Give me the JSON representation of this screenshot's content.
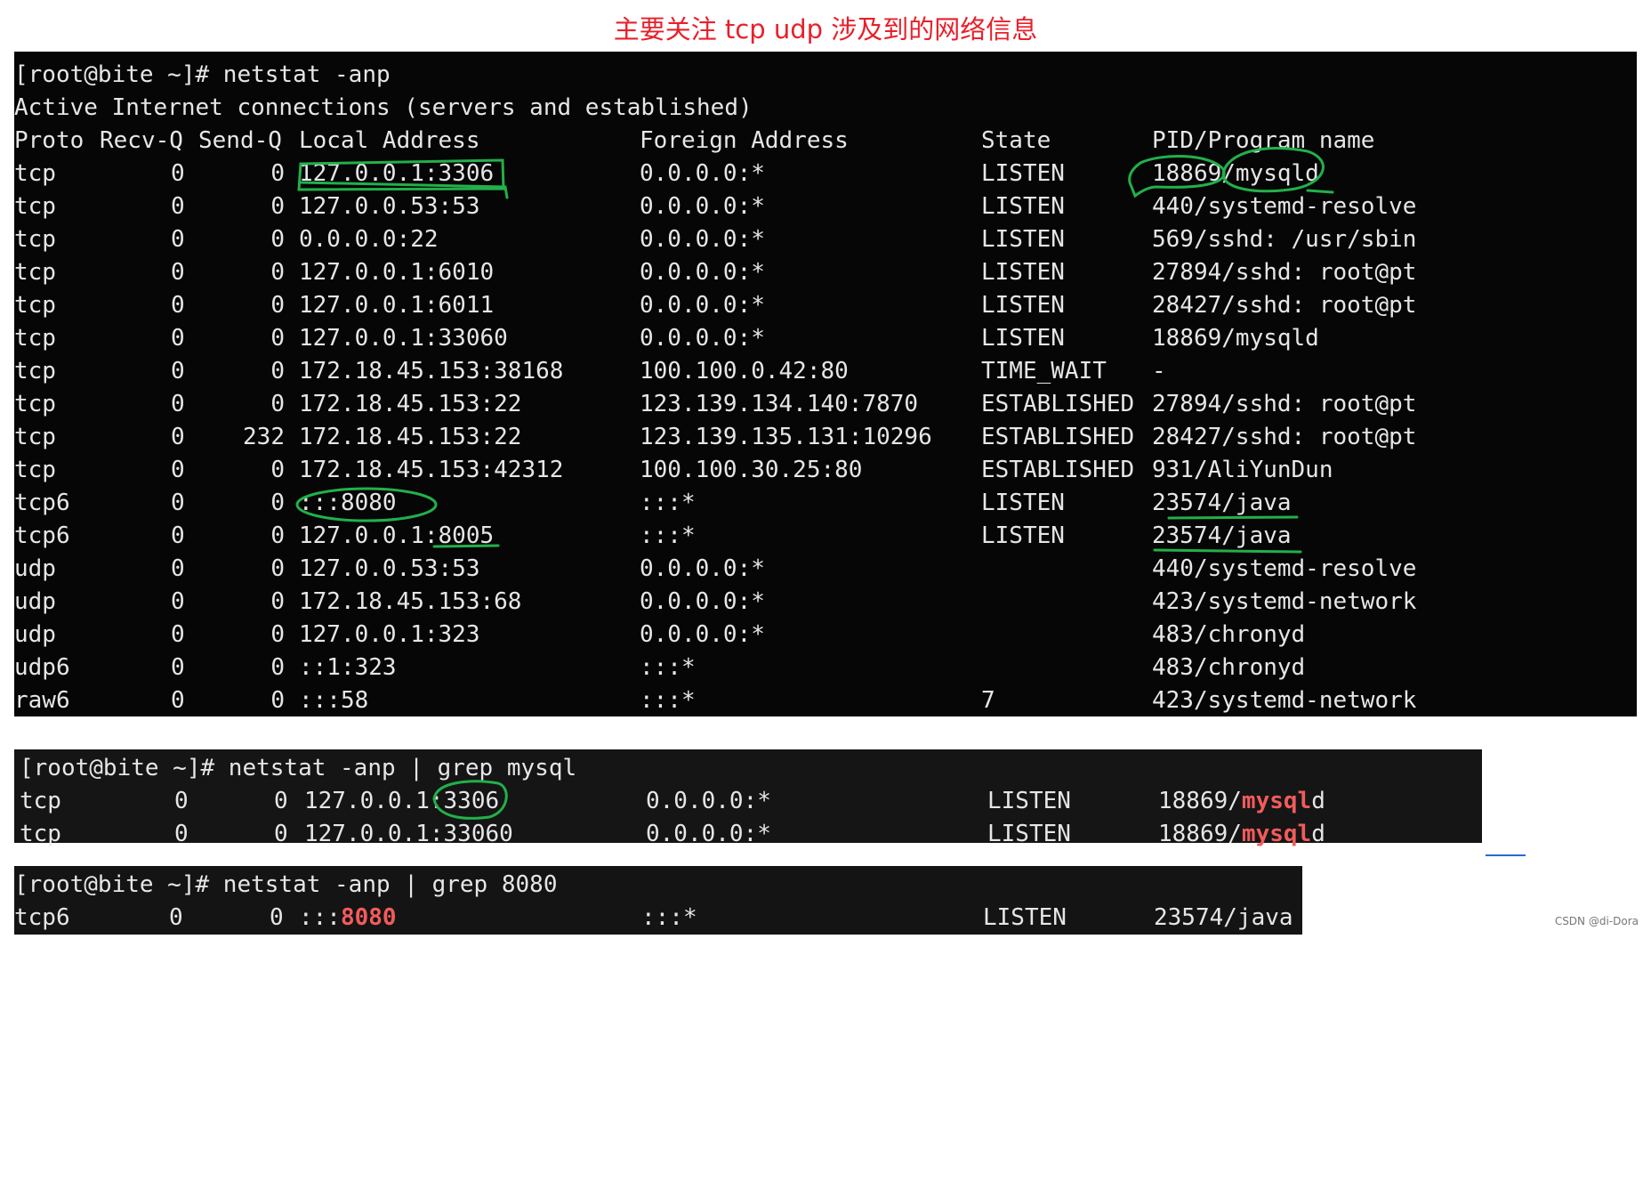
{
  "title": "主要关注 tcp udp 涉及到的网络信息",
  "watermark": "CSDN @di-Dora",
  "term1": {
    "prompt": "[root@bite ~]# netstat -anp",
    "subtitle": "Active Internet connections (servers and established)",
    "headers": {
      "proto": "Proto",
      "recvq": "Recv-Q",
      "sendq": "Send-Q",
      "local": "Local Address",
      "foreign": "Foreign Address",
      "state": "State",
      "pid": "PID/Program name"
    },
    "rows": [
      {
        "proto": "tcp",
        "recvq": "0",
        "sendq": "0",
        "local": "127.0.0.1:3306",
        "foreign": "0.0.0.0:*",
        "state": "LISTEN",
        "pid": "18869/mysqld"
      },
      {
        "proto": "tcp",
        "recvq": "0",
        "sendq": "0",
        "local": "127.0.0.53:53",
        "foreign": "0.0.0.0:*",
        "state": "LISTEN",
        "pid": "440/systemd-resolve"
      },
      {
        "proto": "tcp",
        "recvq": "0",
        "sendq": "0",
        "local": "0.0.0.0:22",
        "foreign": "0.0.0.0:*",
        "state": "LISTEN",
        "pid": "569/sshd: /usr/sbin"
      },
      {
        "proto": "tcp",
        "recvq": "0",
        "sendq": "0",
        "local": "127.0.0.1:6010",
        "foreign": "0.0.0.0:*",
        "state": "LISTEN",
        "pid": "27894/sshd: root@pt"
      },
      {
        "proto": "tcp",
        "recvq": "0",
        "sendq": "0",
        "local": "127.0.0.1:6011",
        "foreign": "0.0.0.0:*",
        "state": "LISTEN",
        "pid": "28427/sshd: root@pt"
      },
      {
        "proto": "tcp",
        "recvq": "0",
        "sendq": "0",
        "local": "127.0.0.1:33060",
        "foreign": "0.0.0.0:*",
        "state": "LISTEN",
        "pid": "18869/mysqld"
      },
      {
        "proto": "tcp",
        "recvq": "0",
        "sendq": "0",
        "local": "172.18.45.153:38168",
        "foreign": "100.100.0.42:80",
        "state": "TIME_WAIT",
        "pid": "-"
      },
      {
        "proto": "tcp",
        "recvq": "0",
        "sendq": "0",
        "local": "172.18.45.153:22",
        "foreign": "123.139.134.140:7870",
        "state": "ESTABLISHED",
        "pid": "27894/sshd: root@pt"
      },
      {
        "proto": "tcp",
        "recvq": "0",
        "sendq": "232",
        "local": "172.18.45.153:22",
        "foreign": "123.139.135.131:10296",
        "state": "ESTABLISHED",
        "pid": "28427/sshd: root@pt"
      },
      {
        "proto": "tcp",
        "recvq": "0",
        "sendq": "0",
        "local": "172.18.45.153:42312",
        "foreign": "100.100.30.25:80",
        "state": "ESTABLISHED",
        "pid": "931/AliYunDun"
      },
      {
        "proto": "tcp6",
        "recvq": "0",
        "sendq": "0",
        "local": ":::8080",
        "foreign": ":::*",
        "state": "LISTEN",
        "pid": "23574/java"
      },
      {
        "proto": "tcp6",
        "recvq": "0",
        "sendq": "0",
        "local": "127.0.0.1:8005",
        "foreign": ":::*",
        "state": "LISTEN",
        "pid": "23574/java"
      },
      {
        "proto": "udp",
        "recvq": "0",
        "sendq": "0",
        "local": "127.0.0.53:53",
        "foreign": "0.0.0.0:*",
        "state": "",
        "pid": "440/systemd-resolve"
      },
      {
        "proto": "udp",
        "recvq": "0",
        "sendq": "0",
        "local": "172.18.45.153:68",
        "foreign": "0.0.0.0:*",
        "state": "",
        "pid": "423/systemd-network"
      },
      {
        "proto": "udp",
        "recvq": "0",
        "sendq": "0",
        "local": "127.0.0.1:323",
        "foreign": "0.0.0.0:*",
        "state": "",
        "pid": "483/chronyd"
      },
      {
        "proto": "udp6",
        "recvq": "0",
        "sendq": "0",
        "local": "::1:323",
        "foreign": ":::*",
        "state": "",
        "pid": "483/chronyd"
      },
      {
        "proto": "raw6",
        "recvq": "0",
        "sendq": "0",
        "local": ":::58",
        "foreign": ":::*",
        "state": "7",
        "pid": "423/systemd-network"
      }
    ]
  },
  "term2": {
    "prompt": "[root@bite ~]# netstat -anp | grep mysql",
    "rows": [
      {
        "proto": "tcp",
        "recvq": "0",
        "sendq": "0",
        "local": "127.0.0.1:3306",
        "foreign": "0.0.0.0:*",
        "state": "LISTEN",
        "pid_prefix": "18869/",
        "pid_match": "mysql",
        "pid_suffix": "d"
      },
      {
        "proto": "tcp",
        "recvq": "0",
        "sendq": "0",
        "local": "127.0.0.1:33060",
        "foreign": "0.0.0.0:*",
        "state": "LISTEN",
        "pid_prefix": "18869/",
        "pid_match": "mysql",
        "pid_suffix": "d"
      }
    ]
  },
  "term3": {
    "prompt": "[root@bite ~]# netstat -anp | grep 8080",
    "row": {
      "proto": "tcp6",
      "recvq": "0",
      "sendq": "0",
      "local_prefix": ":::",
      "local_match": "8080",
      "foreign": ":::*",
      "state": "LISTEN",
      "pid": "23574/java"
    }
  },
  "colors": {
    "title": "#e8202a",
    "match": "#f25b5b",
    "annotation": "#22b04a",
    "terminal_bg": "#060606",
    "text": "#e6e6e6"
  }
}
